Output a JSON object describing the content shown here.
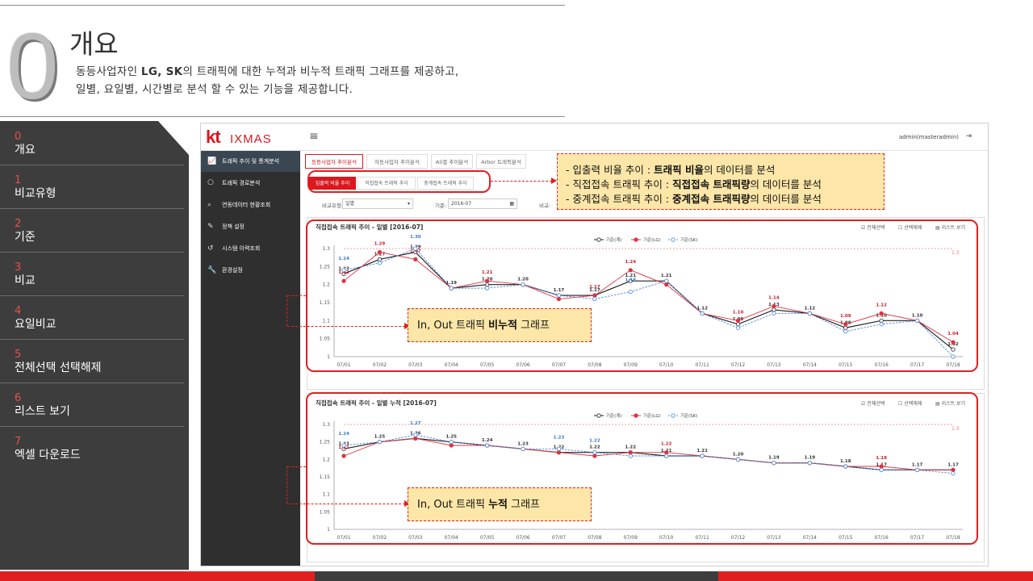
{
  "slide": {
    "number": "0",
    "title": "개요",
    "desc_line1_parts": [
      "동등사업자인 ",
      "LG, SK",
      "의 트래픽에 대한 누적과 비누적 트래픽 그래프를 제공하고,"
    ],
    "desc_line2": "일별, 요일별, 시간별로 분석 할 수 있는 기능을 제공합니다."
  },
  "leftnav": [
    {
      "num": "0",
      "label": "개요"
    },
    {
      "num": "1",
      "label": "비교유형"
    },
    {
      "num": "2",
      "label": "기준"
    },
    {
      "num": "3",
      "label": "비교"
    },
    {
      "num": "4",
      "label": "요일비교"
    },
    {
      "num": "5",
      "label": "전체선택 선택해제"
    },
    {
      "num": "6",
      "label": "리스트 보기"
    },
    {
      "num": "7",
      "label": "엑셀 다운로드"
    }
  ],
  "app": {
    "logo_kt": "kt",
    "logo_name": "IXMAS",
    "hamburger": "≡",
    "user": "admin(masteradmin)",
    "logout_icon": "⇥",
    "sidebar": [
      {
        "icon": "line-chart-icon",
        "glyph": "📈",
        "label": "트래픽 추이 및 통계분석",
        "active": true
      },
      {
        "icon": "route-icon",
        "glyph": "⎔",
        "label": "트래픽 경로분석",
        "active": false
      },
      {
        "icon": "search-icon",
        "glyph": "⌕",
        "label": "연동데이터 현황조회",
        "active": false
      },
      {
        "icon": "policy-icon",
        "glyph": "✎",
        "label": "정책 설정",
        "active": false
      },
      {
        "icon": "history-icon",
        "glyph": "↺",
        "label": "시스템 이력조회",
        "active": false
      },
      {
        "icon": "wrench-icon",
        "glyph": "🔧",
        "label": "환경설정",
        "active": false
      }
    ],
    "tabs": [
      "동등사업자 추이분석",
      "자동사업자 추이분석",
      "AS별 추이분석",
      "Arbor 트래픽분석"
    ],
    "subtabs": [
      "입출력 비율 추이",
      "직접접속 트래픽 추이",
      "중계접속 트래픽 추이"
    ],
    "filters": {
      "compare_type_label": "비교유형:",
      "compare_type_value": "일별",
      "base_label": "기준:",
      "base_value": "2016-07",
      "compare_label": "비교:"
    },
    "panel_controls": {
      "select_all": "전체선택",
      "deselect_all": "선택해제",
      "list_view": "리스트 보기"
    }
  },
  "callouts": {
    "top_lines": [
      {
        "pre": "- 입출력 비율 추이 : ",
        "bold": "트래픽 비율",
        "post": "의 데이터를 분석"
      },
      {
        "pre": "- 직접접속 트래픽 추이 : ",
        "bold": "직접접속 트래픽량",
        "post": "의 데이터를 분석"
      },
      {
        "pre": "- 중계접속 트래픽 추이 : ",
        "bold": "중계접속 트래픽량",
        "post": "의 데이터를 분석"
      }
    ],
    "mid": {
      "pre": "In, Out 트래픽 ",
      "bold": "비누적",
      "post": " 그래프"
    },
    "bottom": {
      "pre": "In, Out 트래픽 ",
      "bold": "누적",
      "post": " 그래프"
    }
  },
  "colors": {
    "accent_red": "#d71920",
    "series_total": "#222222",
    "series_lg": "#e03040",
    "series_sk": "#4a8ad8",
    "ref_line": "#f08080"
  },
  "chart_data": [
    {
      "type": "line",
      "title": "직접접속 트래픽 추이 - 일별 [2016-07]",
      "categories": [
        "07/01",
        "07/02",
        "07/03",
        "07/04",
        "07/05",
        "07/06",
        "07/07",
        "07/08",
        "07/09",
        "07/10",
        "07/11",
        "07/12",
        "07/13",
        "07/14",
        "07/15",
        "07/16",
        "07/17",
        "07/18"
      ],
      "yticks": [
        "1",
        "1.05",
        "1.1",
        "1.15",
        "1.2",
        "1.25",
        "1.3"
      ],
      "ylim": [
        1,
        1.3
      ],
      "ref_line": {
        "value": 1.3,
        "label": "1.3"
      },
      "legend": [
        "기준(계)",
        "기준(LG)",
        "기준(SK)"
      ],
      "series": [
        {
          "name": "기준(계)",
          "values": [
            1.23,
            1.27,
            1.29,
            1.19,
            1.2,
            1.2,
            1.17,
            1.17,
            1.21,
            1.21,
            1.12,
            1.09,
            1.13,
            1.12,
            1.08,
            1.1,
            1.1,
            1.02
          ]
        },
        {
          "name": "기준(LG)",
          "values": [
            1.21,
            1.29,
            1.27,
            1.19,
            1.21,
            1.2,
            1.16,
            1.17,
            1.24,
            1.2,
            1.12,
            1.1,
            1.14,
            1.12,
            1.09,
            1.12,
            1.1,
            1.04
          ]
        },
        {
          "name": "기준(SK)",
          "values": [
            1.24,
            1.26,
            1.3,
            1.19,
            1.19,
            1.2,
            1.17,
            1.16,
            1.18,
            1.21,
            1.12,
            1.08,
            1.12,
            1.12,
            1.07,
            1.09,
            1.1,
            1.0
          ]
        }
      ],
      "data_labels": {
        "기준(계)": [
          "1.23",
          "1.27",
          "1.29",
          "1.19",
          "1.20",
          "1.20",
          "1.17",
          "1.17",
          "1.21",
          "1.21",
          "1.12",
          "1.09",
          "1.13",
          "1.12",
          "1.08",
          "1.10",
          "1.10",
          "1.02"
        ],
        "기준(LG)": [
          "1.21",
          "1.29",
          "1.27",
          "",
          "1.21",
          "",
          "",
          "1.17",
          "1.24",
          "",
          "",
          "1.10",
          "1.14",
          "",
          "1.09",
          "1.12",
          "",
          "1.04"
        ],
        "기준(SK)": [
          "1.24",
          "",
          "1.30",
          "",
          "",
          "",
          "",
          "",
          "1.18",
          "",
          "",
          "",
          "",
          "",
          "",
          "",
          "",
          ""
        ]
      }
    },
    {
      "type": "line",
      "title": "직접접속 트래픽 추이 - 일별 누적 [2016-07]",
      "categories": [
        "07/01",
        "07/02",
        "07/03",
        "07/04",
        "07/05",
        "07/06",
        "07/07",
        "07/08",
        "07/09",
        "07/10",
        "07/11",
        "07/12",
        "07/13",
        "07/14",
        "07/15",
        "07/16",
        "07/17",
        "07/18"
      ],
      "yticks": [
        "1",
        "1.05",
        "1.1",
        "1.15",
        "1.2",
        "1.25",
        "1.3"
      ],
      "ylim": [
        1,
        1.3
      ],
      "ref_line": {
        "value": 1.3,
        "label": "1.3"
      },
      "legend": [
        "기준(계)",
        "기준(LG)",
        "기준(SK)"
      ],
      "series": [
        {
          "name": "기준(계)",
          "values": [
            1.23,
            1.25,
            1.26,
            1.25,
            1.24,
            1.23,
            1.22,
            1.22,
            1.22,
            1.21,
            1.21,
            1.2,
            1.19,
            1.19,
            1.18,
            1.17,
            1.17,
            1.17
          ]
        },
        {
          "name": "기준(LG)",
          "values": [
            1.21,
            1.25,
            1.26,
            1.24,
            1.24,
            1.23,
            1.22,
            1.21,
            1.22,
            1.22,
            1.21,
            1.2,
            1.19,
            1.19,
            1.18,
            1.18,
            1.17,
            1.17
          ]
        },
        {
          "name": "기준(SK)",
          "values": [
            1.24,
            1.25,
            1.27,
            1.25,
            1.24,
            1.23,
            1.23,
            1.22,
            1.21,
            1.21,
            1.21,
            1.2,
            1.19,
            1.19,
            1.18,
            1.17,
            1.17,
            1.16
          ]
        }
      ],
      "data_labels": {
        "기준(계)": [
          "1.23",
          "1.25",
          "1.26",
          "1.25",
          "1.24",
          "1.23",
          "1.22",
          "1.22",
          "1.22",
          "1.21",
          "1.21",
          "1.20",
          "1.19",
          "1.19",
          "1.18",
          "1.17",
          "1.17",
          "1.17"
        ],
        "기준(LG)": [
          "1.21",
          "",
          "",
          "",
          "",
          "",
          "",
          "",
          "",
          "1.22",
          "",
          "",
          "",
          "",
          "",
          "1.18",
          "",
          ""
        ],
        "기준(SK)": [
          "1.24",
          "",
          "1.27",
          "",
          "",
          "",
          "1.23",
          "1.22",
          "",
          "",
          "",
          "",
          "",
          "",
          "",
          "",
          "",
          ""
        ]
      }
    }
  ]
}
